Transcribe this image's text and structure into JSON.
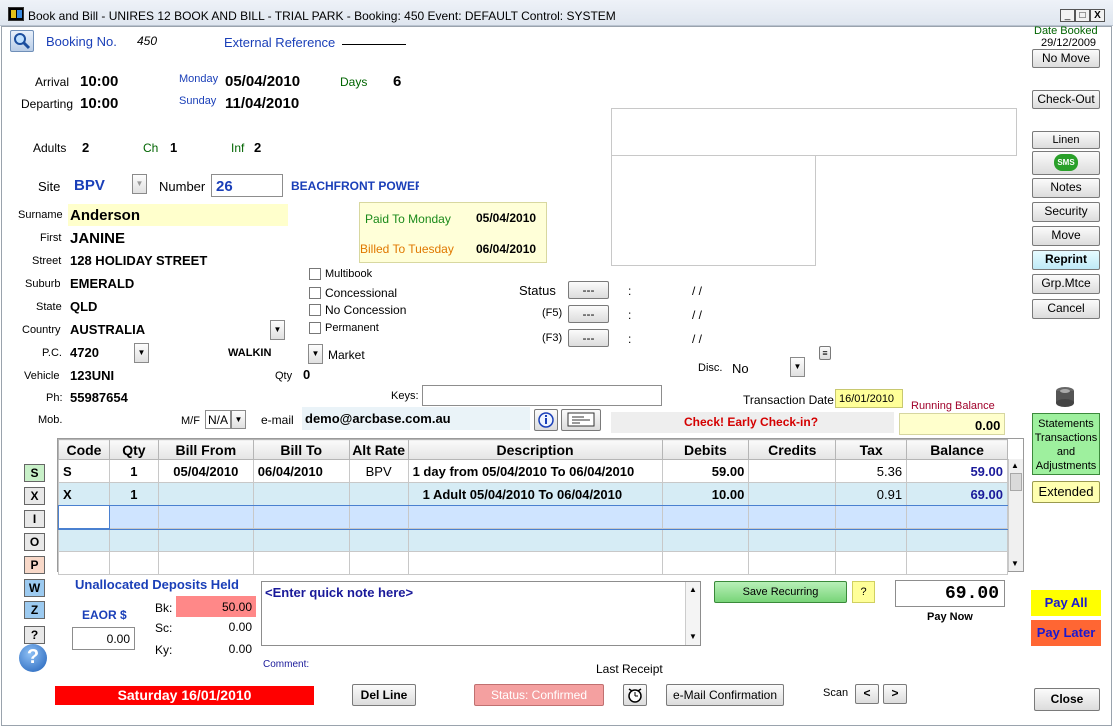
{
  "window": {
    "title": "Book and Bill - UNIRES 12  BOOK AND BILL - TRIAL PARK - Booking: 450 Event: DEFAULT Control: SYSTEM",
    "min": "_",
    "max": "□",
    "close": "X"
  },
  "header": {
    "booking_label": "Booking No.",
    "booking_no": "450",
    "ext_ref_label": "External Reference",
    "date_booked_label": "Date Booked",
    "date_booked": "29/12/2009"
  },
  "stay": {
    "arrival_label": "Arrival",
    "arrival_time": "10:00",
    "arrival_day": "Monday",
    "arrival_date": "05/04/2010",
    "days_label": "Days",
    "days": "6",
    "departing_label": "Departing",
    "departing_time": "10:00",
    "departing_day": "Sunday",
    "departing_date": "11/04/2010"
  },
  "guests": {
    "adults_label": "Adults",
    "adults": "2",
    "ch_label": "Ch",
    "ch": "1",
    "inf_label": "Inf",
    "inf": "2"
  },
  "site": {
    "site_label": "Site",
    "site": "BPV",
    "number_label": "Number",
    "number": "26",
    "desc": "BEACHFRONT POWERE"
  },
  "guest": {
    "surname_label": "Surname",
    "surname": "Anderson",
    "first_label": "First",
    "first": "JANINE",
    "street_label": "Street",
    "street": "128 HOLIDAY STREET",
    "suburb_label": "Suburb",
    "suburb": "EMERALD",
    "state_label": "State",
    "state": "QLD",
    "country_label": "Country",
    "country": "AUSTRALIA",
    "pc_label": "P.C.",
    "pc": "4720",
    "walkin": "WALKIN",
    "market": "Market",
    "vehicle_label": "Vehicle",
    "vehicle": "123UNI",
    "qty_label": "Qty",
    "qty": "0",
    "ph_label": "Ph:",
    "ph": "55987654",
    "mob_label": "Mob.",
    "mf_label": "M/F",
    "mf": "N/A",
    "email_label": "e-mail",
    "email": "demo@arcbase.com.au",
    "keys_label": "Keys:"
  },
  "paid": {
    "paid_label": "Paid To Monday",
    "paid_date": "05/04/2010",
    "billed_label": "Billed To Tuesday",
    "billed_date": "06/04/2010"
  },
  "options": {
    "multibook": "Multibook",
    "concessional": "Concessional",
    "no_concession": "No Concession",
    "permanent": "Permanent"
  },
  "status": {
    "status_label": "Status",
    "f5_label": "(F5)",
    "f3_label": "(F3)",
    "btn": "---",
    "colon": ":",
    "slash": "/ /",
    "disc_label": "Disc.",
    "disc": "No",
    "trans_date_label": "Transaction Date :",
    "trans_date": "16/01/2010",
    "warning": "Check! Early Check-in?",
    "running_balance_label": "Running Balance",
    "running_balance": "0.00"
  },
  "right_buttons": {
    "no_move": "No Move",
    "check_out": "Check-Out",
    "linen": "Linen",
    "sms": "SMS",
    "notes": "Notes",
    "security": "Security",
    "move": "Move",
    "reprint": "Reprint",
    "grp_mtce": "Grp.Mtce",
    "cancel": "Cancel",
    "statements": "Statements Transactions and Adjustments",
    "extended": "Extended",
    "pay_all": "Pay All",
    "pay_later": "Pay Later",
    "close": "Close"
  },
  "grid": {
    "headers": [
      "Code",
      "Qty",
      "Bill From",
      "Bill To",
      "Alt Rate",
      "Description",
      "Debits",
      "Credits",
      "Tax",
      "Balance"
    ],
    "rows": [
      {
        "code": "S",
        "qty": "1",
        "bill_from": "05/04/2010",
        "bill_to": "06/04/2010",
        "alt_rate": "BPV",
        "desc": "1 day from 05/04/2010 To 06/04/2010",
        "debits": "59.00",
        "credits": "",
        "tax": "5.36",
        "balance": "59.00"
      },
      {
        "code": "X",
        "qty": "1",
        "bill_from": "",
        "bill_to": "",
        "alt_rate": "",
        "desc": "1 Adult 05/04/2010 To 06/04/2010",
        "debits": "10.00",
        "credits": "",
        "tax": "0.91",
        "balance": "69.00"
      }
    ]
  },
  "row_buttons": [
    "S",
    "X",
    "I",
    "O",
    "P",
    "W",
    "Z",
    "?"
  ],
  "deposits": {
    "title": "Unallocated Deposits Held",
    "eaor_label": "EAOR $",
    "eaor": "0.00",
    "bk_label": "Bk:",
    "bk": "50.00",
    "sc_label": "Sc:",
    "sc": "0.00",
    "ky_label": "Ky:",
    "ky": "0.00"
  },
  "note": {
    "placeholder": "<Enter quick note here>",
    "comment_label": "Comment:",
    "last_receipt_label": "Last Receipt"
  },
  "pay": {
    "save_recurring": "Save Recurring",
    "question": "?",
    "amount": "69.00",
    "pay_now": "Pay Now"
  },
  "footer": {
    "date": "Saturday 16/01/2010",
    "del_line": "Del Line",
    "status_confirmed": "Status: Confirmed",
    "email_confirmation": "e-Mail Confirmation",
    "scan_label": "Scan",
    "prev": "<",
    "next": ">"
  },
  "colors": {
    "label_blue": "#1a3fb8",
    "highlight_yellow": "#ffffcc",
    "row_alt": "#d6ecf5",
    "selected_row": "#cfe4ff",
    "warning_red": "#d40000",
    "date_bar": "#ff0000",
    "pay_all_bg": "#ffff00",
    "pay_later_bg": "#ff6633"
  }
}
